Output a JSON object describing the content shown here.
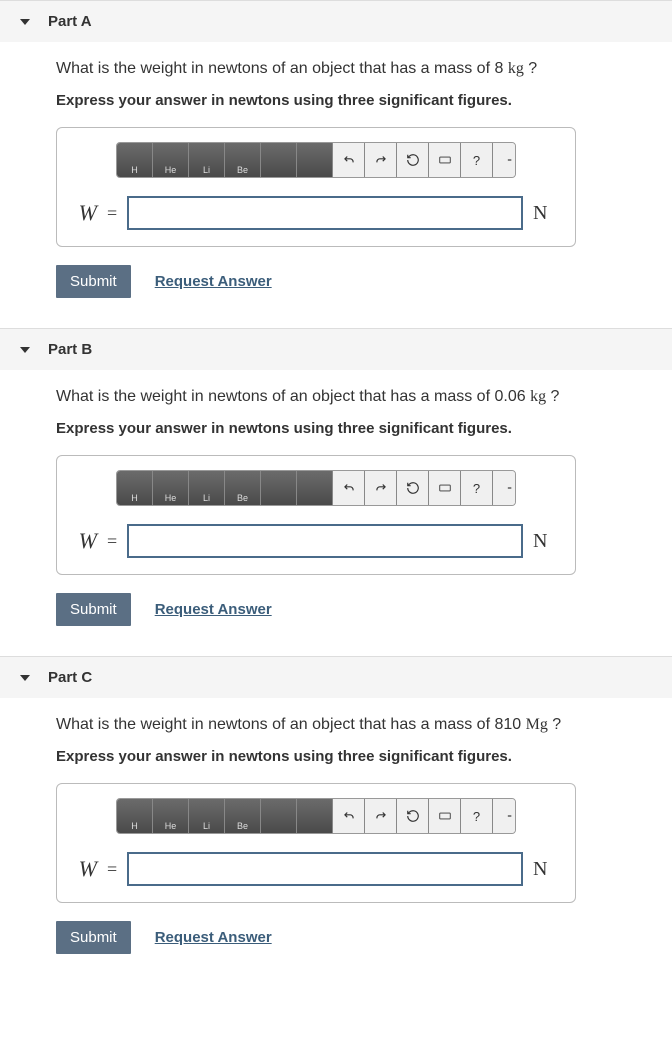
{
  "parts": [
    {
      "title": "Part A",
      "question_prefix": "What is the weight in newtons of an object that has a mass of ",
      "mass_value": "8",
      "mass_unit": "kg",
      "question_suffix": " ?",
      "instruction": "Express your answer in newtons using three significant figures.",
      "variable": "W",
      "equals": "=",
      "answer_value": "",
      "answer_unit": "N",
      "submit_label": "Submit",
      "request_label": "Request Answer"
    },
    {
      "title": "Part B",
      "question_prefix": "What is the weight in newtons of an object that has a mass of ",
      "mass_value": "0.06",
      "mass_unit": "kg",
      "question_suffix": " ?",
      "instruction": "Express your answer in newtons using three significant figures.",
      "variable": "W",
      "equals": "=",
      "answer_value": "",
      "answer_unit": "N",
      "submit_label": "Submit",
      "request_label": "Request Answer"
    },
    {
      "title": "Part C",
      "question_prefix": "What is the weight in newtons of an object that has a mass of ",
      "mass_value": "810",
      "mass_unit": "Mg",
      "question_suffix": " ?",
      "instruction": "Express your answer in newtons using three significant figures.",
      "variable": "W",
      "equals": "=",
      "answer_value": "",
      "answer_unit": "N",
      "submit_label": "Submit",
      "request_label": "Request Answer"
    }
  ],
  "toolbar": {
    "btn1": "H",
    "btn2": "He",
    "btn3": "Li",
    "btn4": "Be",
    "help": "?"
  }
}
